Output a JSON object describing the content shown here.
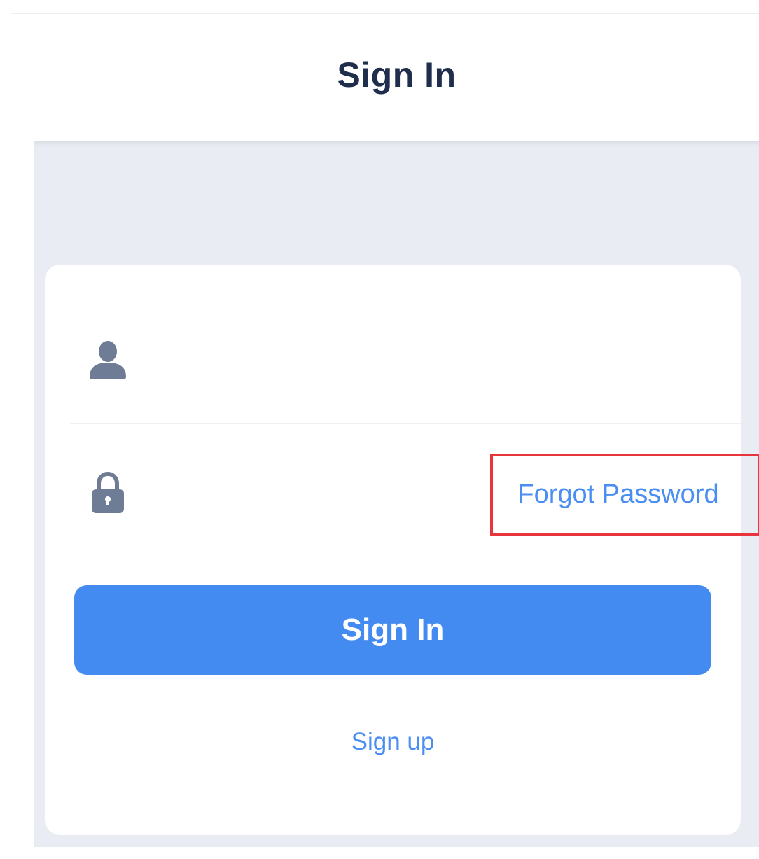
{
  "header": {
    "title": "Sign In"
  },
  "form": {
    "username": {
      "icon": "user-icon",
      "value": "",
      "placeholder": ""
    },
    "password": {
      "icon": "lock-icon",
      "value": "",
      "placeholder": ""
    },
    "forgot_password_label": "Forgot Password",
    "submit_label": "Sign In",
    "signup_label": "Sign up"
  },
  "colors": {
    "title_text": "#1f2e4d",
    "background": "#e9edf3",
    "primary_button": "#438bf0",
    "link": "#4a8ef2",
    "icon": "#6e7d95",
    "highlight_box": "#e8353c"
  }
}
